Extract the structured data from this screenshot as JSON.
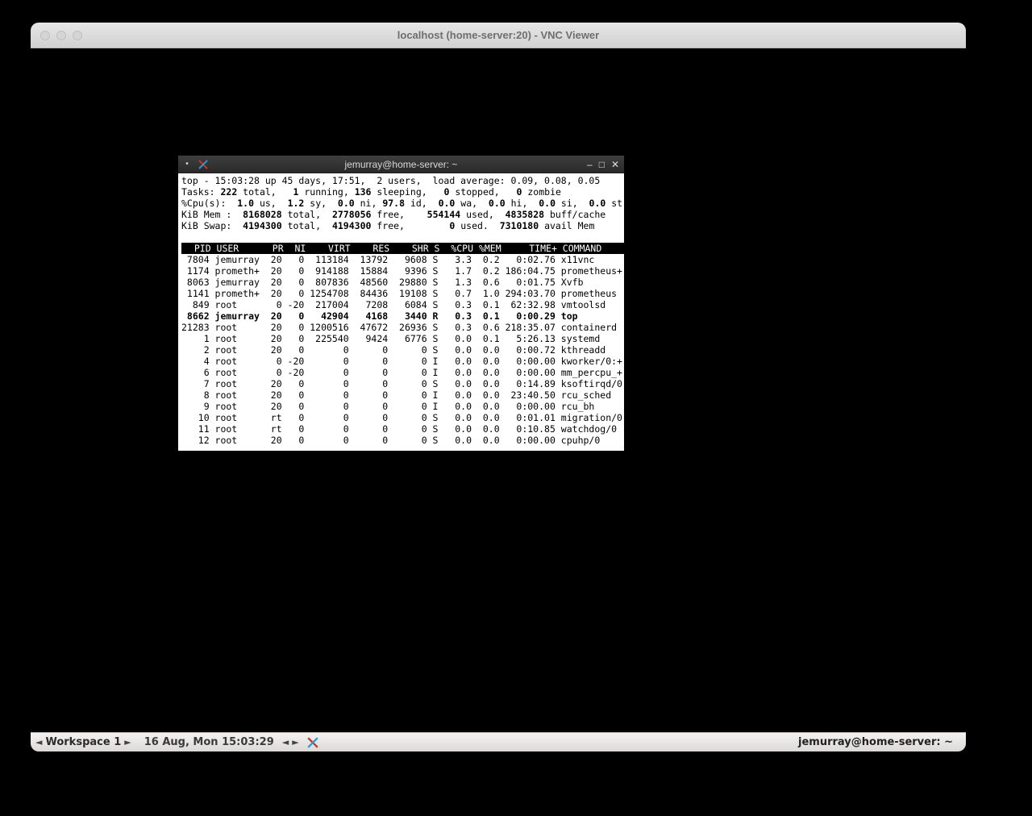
{
  "mac": {
    "title": "localhost (home-server:20) - VNC Viewer"
  },
  "terminal": {
    "title": "jemurray@home-server: ~",
    "minimize_glyph": "–",
    "maximize_glyph": "□",
    "close_glyph": "✕"
  },
  "top": {
    "summary": {
      "line1": "top - 15:03:28 up 45 days, 17:51,  2 users,  load average: 0.09, 0.08, 0.05",
      "tasks": {
        "total": "222",
        "running": "1",
        "sleeping": "136",
        "stopped": "0",
        "zombie": "0"
      },
      "cpu": {
        "us": "1.0",
        "sy": "1.2",
        "ni": "0.0",
        "id": "97.8",
        "wa": "0.0",
        "hi": "0.0",
        "si": "0.0",
        "st": "0.0"
      },
      "mem": {
        "total": "8168028",
        "free": "2778056",
        "used": "554144",
        "buff": "4835828"
      },
      "swap": {
        "total": "4194300",
        "free": "4194300",
        "used": "0",
        "avail": "7310180"
      }
    },
    "header": "  PID USER      PR  NI    VIRT    RES    SHR S  %CPU %MEM     TIME+ COMMAND    ",
    "processes": [
      {
        "pid": "7804",
        "user": "jemurray",
        "pr": "20",
        "ni": "0",
        "virt": "113184",
        "res": "13792",
        "shr": "9608",
        "s": "S",
        "cpu": "3.3",
        "mem": "0.2",
        "time": "0:02.76",
        "cmd": "x11vnc",
        "highlight": false
      },
      {
        "pid": "1174",
        "user": "prometh+",
        "pr": "20",
        "ni": "0",
        "virt": "914188",
        "res": "15884",
        "shr": "9396",
        "s": "S",
        "cpu": "1.7",
        "mem": "0.2",
        "time": "186:04.75",
        "cmd": "prometheus+",
        "highlight": false
      },
      {
        "pid": "8063",
        "user": "jemurray",
        "pr": "20",
        "ni": "0",
        "virt": "807836",
        "res": "48560",
        "shr": "29880",
        "s": "S",
        "cpu": "1.3",
        "mem": "0.6",
        "time": "0:01.75",
        "cmd": "Xvfb",
        "highlight": false
      },
      {
        "pid": "1141",
        "user": "prometh+",
        "pr": "20",
        "ni": "0",
        "virt": "1254708",
        "res": "84436",
        "shr": "19108",
        "s": "S",
        "cpu": "0.7",
        "mem": "1.0",
        "time": "294:03.70",
        "cmd": "prometheus",
        "highlight": false
      },
      {
        "pid": "849",
        "user": "root",
        "pr": "0",
        "ni": "-20",
        "virt": "217004",
        "res": "7208",
        "shr": "6084",
        "s": "S",
        "cpu": "0.3",
        "mem": "0.1",
        "time": "62:32.98",
        "cmd": "vmtoolsd",
        "highlight": false
      },
      {
        "pid": "8662",
        "user": "jemurray",
        "pr": "20",
        "ni": "0",
        "virt": "42904",
        "res": "4168",
        "shr": "3440",
        "s": "R",
        "cpu": "0.3",
        "mem": "0.1",
        "time": "0:00.29",
        "cmd": "top",
        "highlight": true
      },
      {
        "pid": "21283",
        "user": "root",
        "pr": "20",
        "ni": "0",
        "virt": "1200516",
        "res": "47672",
        "shr": "26936",
        "s": "S",
        "cpu": "0.3",
        "mem": "0.6",
        "time": "218:35.07",
        "cmd": "containerd",
        "highlight": false
      },
      {
        "pid": "1",
        "user": "root",
        "pr": "20",
        "ni": "0",
        "virt": "225540",
        "res": "9424",
        "shr": "6776",
        "s": "S",
        "cpu": "0.0",
        "mem": "0.1",
        "time": "5:26.13",
        "cmd": "systemd",
        "highlight": false
      },
      {
        "pid": "2",
        "user": "root",
        "pr": "20",
        "ni": "0",
        "virt": "0",
        "res": "0",
        "shr": "0",
        "s": "S",
        "cpu": "0.0",
        "mem": "0.0",
        "time": "0:00.72",
        "cmd": "kthreadd",
        "highlight": false
      },
      {
        "pid": "4",
        "user": "root",
        "pr": "0",
        "ni": "-20",
        "virt": "0",
        "res": "0",
        "shr": "0",
        "s": "I",
        "cpu": "0.0",
        "mem": "0.0",
        "time": "0:00.00",
        "cmd": "kworker/0:+",
        "highlight": false
      },
      {
        "pid": "6",
        "user": "root",
        "pr": "0",
        "ni": "-20",
        "virt": "0",
        "res": "0",
        "shr": "0",
        "s": "I",
        "cpu": "0.0",
        "mem": "0.0",
        "time": "0:00.00",
        "cmd": "mm_percpu_+",
        "highlight": false
      },
      {
        "pid": "7",
        "user": "root",
        "pr": "20",
        "ni": "0",
        "virt": "0",
        "res": "0",
        "shr": "0",
        "s": "S",
        "cpu": "0.0",
        "mem": "0.0",
        "time": "0:14.89",
        "cmd": "ksoftirqd/0",
        "highlight": false
      },
      {
        "pid": "8",
        "user": "root",
        "pr": "20",
        "ni": "0",
        "virt": "0",
        "res": "0",
        "shr": "0",
        "s": "I",
        "cpu": "0.0",
        "mem": "0.0",
        "time": "23:40.50",
        "cmd": "rcu_sched",
        "highlight": false
      },
      {
        "pid": "9",
        "user": "root",
        "pr": "20",
        "ni": "0",
        "virt": "0",
        "res": "0",
        "shr": "0",
        "s": "I",
        "cpu": "0.0",
        "mem": "0.0",
        "time": "0:00.00",
        "cmd": "rcu_bh",
        "highlight": false
      },
      {
        "pid": "10",
        "user": "root",
        "pr": "rt",
        "ni": "0",
        "virt": "0",
        "res": "0",
        "shr": "0",
        "s": "S",
        "cpu": "0.0",
        "mem": "0.0",
        "time": "0:01.01",
        "cmd": "migration/0",
        "highlight": false
      },
      {
        "pid": "11",
        "user": "root",
        "pr": "rt",
        "ni": "0",
        "virt": "0",
        "res": "0",
        "shr": "0",
        "s": "S",
        "cpu": "0.0",
        "mem": "0.0",
        "time": "0:10.85",
        "cmd": "watchdog/0",
        "highlight": false
      },
      {
        "pid": "12",
        "user": "root",
        "pr": "20",
        "ni": "0",
        "virt": "0",
        "res": "0",
        "shr": "0",
        "s": "S",
        "cpu": "0.0",
        "mem": "0.0",
        "time": "0:00.00",
        "cmd": "cpuhp/0",
        "highlight": false
      }
    ]
  },
  "taskbar": {
    "workspace_label": "Workspace 1",
    "clock": "16 Aug, Mon 15:03:29",
    "active_task": "jemurray@home-server: ~"
  }
}
